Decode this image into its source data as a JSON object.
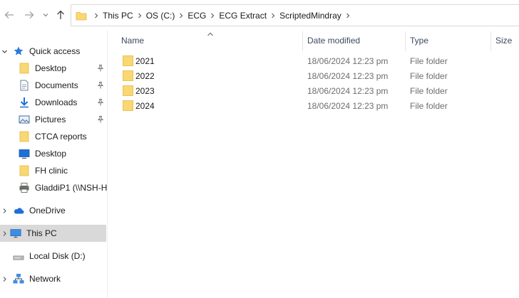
{
  "address": {
    "crumbs": [
      "This PC",
      "OS (C:)",
      "ECG",
      "ECG Extract",
      "ScriptedMindray"
    ]
  },
  "columns": {
    "name": "Name",
    "date": "Date modified",
    "type": "Type",
    "size": "Size"
  },
  "files": [
    {
      "name": "2021",
      "date": "18/06/2024 12:23 pm",
      "type": "File folder"
    },
    {
      "name": "2022",
      "date": "18/06/2024 12:23 pm",
      "type": "File folder"
    },
    {
      "name": "2023",
      "date": "18/06/2024 12:23 pm",
      "type": "File folder"
    },
    {
      "name": "2024",
      "date": "18/06/2024 12:23 pm",
      "type": "File folder"
    }
  ],
  "sidebar": {
    "quick_access": "Quick access",
    "items": [
      {
        "label": "Desktop"
      },
      {
        "label": "Documents"
      },
      {
        "label": "Downloads"
      },
      {
        "label": "Pictures"
      },
      {
        "label": "CTCA reports"
      },
      {
        "label": "Desktop"
      },
      {
        "label": "FH clinic"
      },
      {
        "label": "GladdiP1 (\\\\NSH-H"
      }
    ],
    "onedrive": "OneDrive",
    "this_pc": "This PC",
    "local_disk": "Local Disk (D:)",
    "network": "Network"
  },
  "colors": {
    "folder": "#f8d775",
    "folder_dark": "#e8b93c",
    "selected_bg": "#d9d9d9",
    "accent_blue": "#1e6fd9"
  }
}
